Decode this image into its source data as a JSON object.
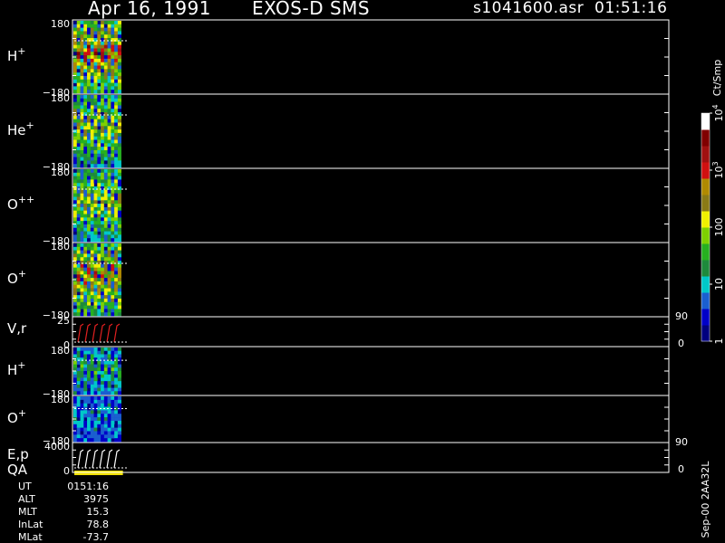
{
  "header": {
    "date": "Apr 16, 1991",
    "instrument": "EXOS-D SMS",
    "file_time": "s1041600.asr  01:51:16"
  },
  "colorbar": {
    "unit": "Ct/Smp",
    "ticks": [
      {
        "label": "1",
        "sup": ""
      },
      {
        "label": "10",
        "sup": ""
      },
      {
        "label": "100",
        "sup": ""
      },
      {
        "label": "10",
        "sup": "3"
      },
      {
        "label": "10",
        "sup": "4"
      }
    ],
    "colors": [
      "#00007f",
      "#0000c8",
      "#1a5fd0",
      "#00c8c8",
      "#1e8a3c",
      "#26b020",
      "#7ed000",
      "#f0f000",
      "#8a7a16",
      "#b08a00",
      "#d01010",
      "#a01010",
      "#800000",
      "#ffffff"
    ]
  },
  "footer": {
    "version": "Sep-00 2AA32L"
  },
  "ephemeris": [
    {
      "key": "UT",
      "value": "0151:16"
    },
    {
      "key": "ALT",
      "value": "3975"
    },
    {
      "key": "MLT",
      "value": "15.3"
    },
    {
      "key": "InLat",
      "value": "78.8"
    },
    {
      "key": "MLat",
      "value": "-73.7"
    }
  ],
  "chart_data": {
    "type": "heatmap",
    "panels": [
      {
        "id": "H+",
        "base": "H",
        "sup": "+",
        "ylim": [
          -180,
          180
        ],
        "tick_top": "180",
        "tick_bottom": "−180",
        "kind": "spectrogram",
        "intensity": "high"
      },
      {
        "id": "He+",
        "base": "He",
        "sup": "+",
        "ylim": [
          -180,
          180
        ],
        "tick_top": "180",
        "tick_bottom": "−180",
        "kind": "spectrogram",
        "intensity": "medium"
      },
      {
        "id": "O++",
        "base": "O",
        "sup": "++",
        "ylim": [
          -180,
          180
        ],
        "tick_top": "180",
        "tick_bottom": "−180",
        "kind": "spectrogram",
        "intensity": "medium"
      },
      {
        "id": "O+",
        "base": "O",
        "sup": "+",
        "ylim": [
          -180,
          180
        ],
        "tick_top": "180",
        "tick_bottom": "−180",
        "kind": "spectrogram",
        "intensity": "medium-high"
      },
      {
        "id": "V,r",
        "base": "V,r",
        "sup": "",
        "ylim": [
          0,
          25
        ],
        "tick_top": "25",
        "tick_bottom": "0",
        "right_top": "90",
        "right_bottom": "0",
        "kind": "line"
      },
      {
        "id": "H+ (2)",
        "base": "H",
        "sup": "+",
        "ylim": [
          -180,
          180
        ],
        "tick_top": "180",
        "tick_bottom": "−180",
        "kind": "spectrogram",
        "intensity": "low"
      },
      {
        "id": "O+ (2)",
        "base": "O",
        "sup": "+",
        "ylim": [
          -180,
          180
        ],
        "tick_top": "180",
        "tick_bottom": "−180",
        "kind": "spectrogram",
        "intensity": "very-low"
      },
      {
        "id": "E,p",
        "base": "E,p",
        "sup": "",
        "ylim": [
          0,
          4000
        ],
        "tick_top": "4000",
        "tick_bottom": "0",
        "right_top": "90",
        "right_bottom": "0",
        "kind": "line"
      }
    ],
    "qa_label": "QA",
    "data_extent_fraction": 0.08,
    "spin_count": 6,
    "count_scale": "log",
    "count_range": [
      1,
      10000
    ]
  }
}
